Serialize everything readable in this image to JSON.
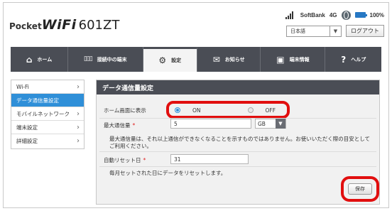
{
  "header": {
    "logo_pocket": "Pocket",
    "logo_wifi": "WiFi",
    "logo_model": "601ZT",
    "carrier": "SoftBank",
    "network": "4G",
    "battery": "100%",
    "language": "日本語",
    "logout_label": "ログアウト"
  },
  "nav": {
    "items": [
      {
        "label": "ホーム",
        "icon": "home-icon",
        "glyph": "🏠"
      },
      {
        "label": "接続中の端末",
        "icon": "devices-icon",
        "glyph": "▯▯▯"
      },
      {
        "label": "設定",
        "icon": "gear-icon",
        "glyph": "⚙"
      },
      {
        "label": "お知らせ",
        "icon": "mail-icon",
        "glyph": "✉"
      },
      {
        "label": "端末情報",
        "icon": "device-info-icon",
        "glyph": "▣"
      },
      {
        "label": "ヘルプ",
        "icon": "help-icon",
        "glyph": "?"
      }
    ],
    "active_index": 2
  },
  "sidebar": {
    "items": [
      {
        "label": "Wi-Fi"
      },
      {
        "label": "データ通信量設定"
      },
      {
        "label": "モバイルネットワーク"
      },
      {
        "label": "端末設定"
      },
      {
        "label": "詳細設定"
      }
    ],
    "active_index": 1
  },
  "main": {
    "title": "データ通信量設定",
    "home_display_label": "ホーム画面に表示",
    "on_label": "ON",
    "off_label": "OFF",
    "selected": "ON",
    "max_label": "最大通信量",
    "max_value": "5",
    "unit": "GB",
    "note": "最大通信量は、それ以上通信ができなくなることを示すものではありません。お使いいただく際の目安としてご利用ください。",
    "reset_label": "自動リセット日",
    "reset_value": "31",
    "reset_note": "毎月セットされた日にデータをリセットします。",
    "save_label": "保存"
  },
  "colors": {
    "nav_bg": "#4a4d55",
    "accent_blue": "#2f8fd8",
    "highlight_red": "#e10e0e"
  }
}
